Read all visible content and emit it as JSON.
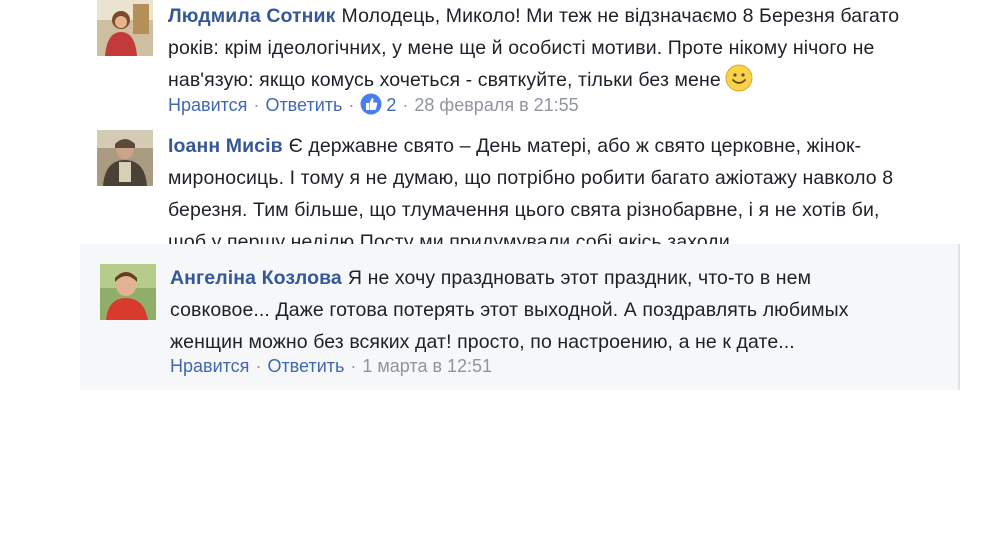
{
  "comments": [
    {
      "author": "Людмила Сотник",
      "text": "Молодець, Миколо! Ми теж не відзначаємо 8 Березня багато років: крім ідеологічних, у мене ще й особисті мотиви. Проте нікому нічого не нав'язую: якщо комусь хочеться - святкуйте, тільки без мене",
      "like_label": "Нравится",
      "reply_label": "Ответить",
      "likes": "2",
      "time": "28 февраля в 21:55"
    },
    {
      "author": "Іоанн Мисів",
      "text": "Є державне свято – День матері, або ж свято церковне, жінок-мироносиць. І тому я не думаю, що потрібно робити багато ажіотажу навколо 8 березня. Тим більше, що тлумачення цього свята різнобарвне, і я не хотів би, щоб у першу неділю Посту ми придумували собі якісь заходи,"
    },
    {
      "author": "Ангеліна Козлова",
      "text": "Я не хочу праздновать этот праздник, что-то в нем совковое... Даже готова потерять этот выходной. А поздравлять любимых женщин можно без всяких дат! просто, по настроению, а не к дате...",
      "like_label": "Нравится",
      "reply_label": "Ответить",
      "time": "1 марта в 12:51"
    }
  ],
  "colors": {
    "author": "#365899",
    "link": "#4267b2",
    "meta": "#90949c",
    "highlight_bg": "#f6f7f9"
  },
  "icons": [
    "avatar",
    "like-reaction-icon",
    "smile-emoji-icon"
  ]
}
